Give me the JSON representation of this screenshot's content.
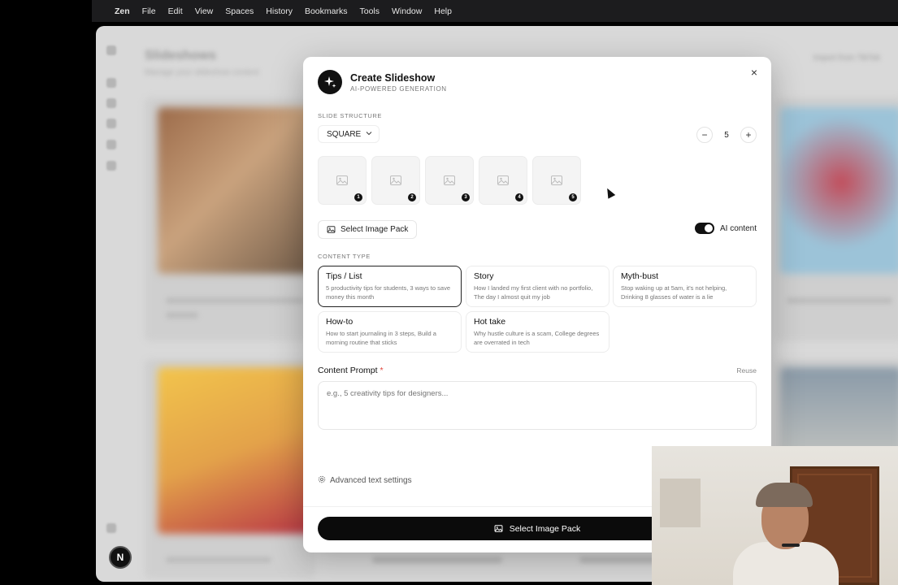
{
  "menubar": {
    "app": "Zen",
    "items": [
      "File",
      "Edit",
      "View",
      "Spaces",
      "History",
      "Bookmarks",
      "Tools",
      "Window",
      "Help"
    ]
  },
  "background": {
    "title": "Slideshows",
    "subtitle": "Manage your slideshow content",
    "import_label": "Import from TikTok",
    "fab_label": "N"
  },
  "modal": {
    "title": "Create Slideshow",
    "subtitle": "AI-POWERED GENERATION",
    "close_glyph": "×",
    "slide_structure_label": "SLIDE STRUCTURE",
    "structure_value": "SQUARE",
    "slide_count": "5",
    "minus_glyph": "−",
    "plus_glyph": "+",
    "slides": [
      "1",
      "2",
      "3",
      "4",
      "5"
    ],
    "select_pack_label": "Select Image Pack",
    "ai_content_label": "AI content",
    "ai_content_on": true,
    "content_type_label": "CONTENT TYPE",
    "content_types": [
      {
        "title": "Tips / List",
        "desc": "5 productivity tips for students, 3 ways to save money this month",
        "selected": true
      },
      {
        "title": "Story",
        "desc": "How I landed my first client with no portfolio, The day I almost quit my job",
        "selected": false
      },
      {
        "title": "Myth-bust",
        "desc": "Stop waking up at 5am, it's not helping, Drinking 8 glasses of water is a lie",
        "selected": false
      },
      {
        "title": "How-to",
        "desc": "How to start journaling in 3 steps, Build a morning routine that sticks",
        "selected": false
      },
      {
        "title": "Hot take",
        "desc": "Why hustle culture is a scam, College degrees are overrated in tech",
        "selected": false
      }
    ],
    "prompt_label": "Content Prompt",
    "prompt_required": "*",
    "reuse_label": "Reuse",
    "prompt_placeholder": "e.g., 5 creativity tips for designers...",
    "advanced_label": "Advanced text settings",
    "primary_label": "Select Image Pack"
  },
  "colors": {
    "accent": "#0b0b0b",
    "required": "#e0443a"
  }
}
